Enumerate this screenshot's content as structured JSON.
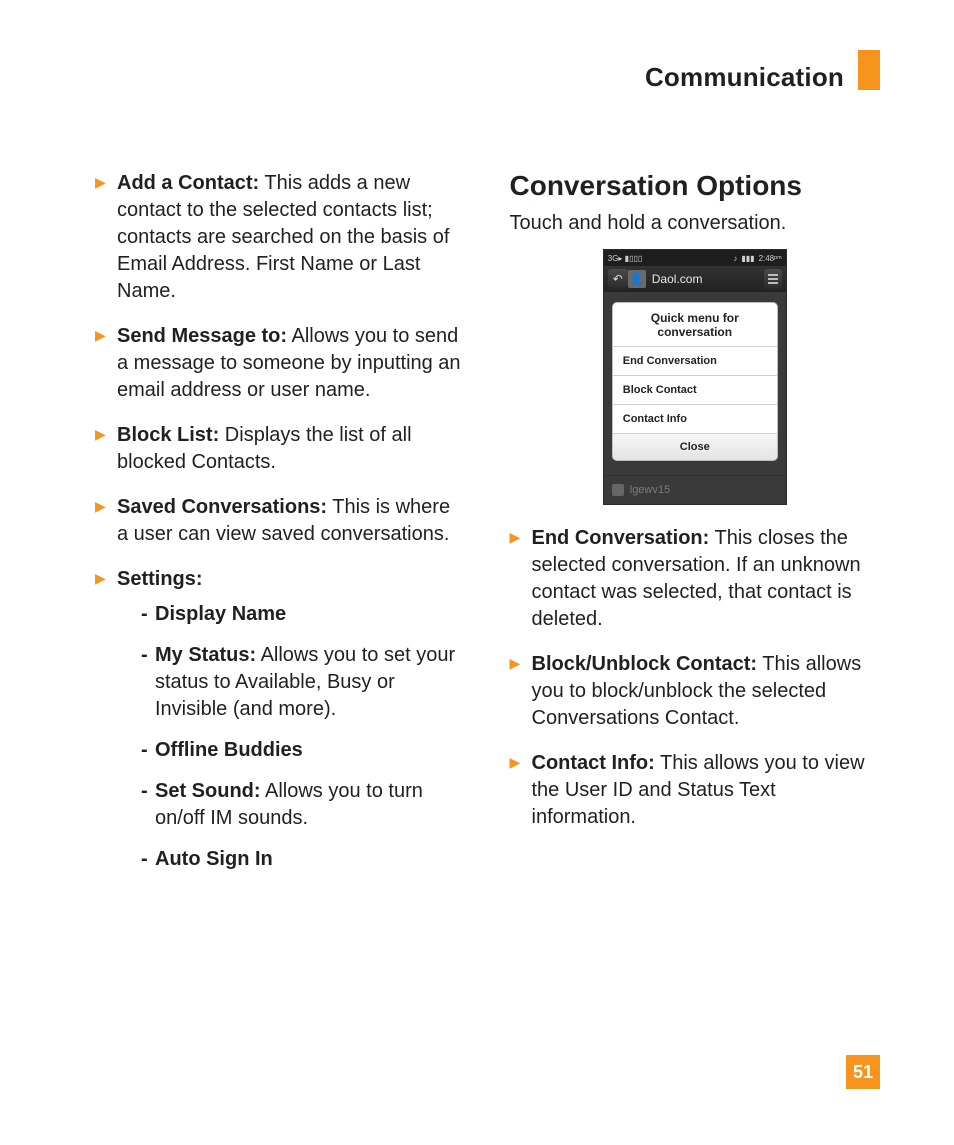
{
  "header": {
    "section": "Communication"
  },
  "page_number": "51",
  "left": {
    "items": [
      {
        "label": "Add a Contact:",
        "text": " This adds a new contact to the selected contacts list; contacts are searched on the basis of Email Address. First Name or Last Name."
      },
      {
        "label": "Send Message to:",
        "text": " Allows you to send a message to someone by inputting an email address or user name."
      },
      {
        "label": "Block List:",
        "text": " Displays the list of all blocked Contacts."
      },
      {
        "label": "Saved Conversations:",
        "text": " This is where a user can view saved conversations."
      },
      {
        "label": "Settings:",
        "text": ""
      }
    ],
    "settings_sub": [
      {
        "label": "Display Name",
        "text": ""
      },
      {
        "label": "My Status:",
        "text": " Allows you to set your status to Available, Busy or Invisible (and more)."
      },
      {
        "label": "Offline Buddies",
        "text": ""
      },
      {
        "label": "Set Sound:",
        "text": " Allows you to turn on/off IM sounds."
      },
      {
        "label": "Auto Sign In",
        "text": ""
      }
    ]
  },
  "right": {
    "heading": "Conversation Options",
    "intro": "Touch and hold a conversation.",
    "items": [
      {
        "label": "End Conversation:",
        "text": " This closes the selected conversation. If an unknown contact was selected, that contact is deleted."
      },
      {
        "label": "Block/Unblock Contact:",
        "text": " This allows you to block/unblock the selected Conversations Contact."
      },
      {
        "label": "Contact Info:",
        "text": " This allows you to view the User ID and Status Text information."
      }
    ]
  },
  "phone": {
    "status_left": "3G▸ ▮▯▯▯",
    "status_right": "2:48ᵖᵐ",
    "title": "Daol.com",
    "card_title_1": "Quick menu for",
    "card_title_2": "conversation",
    "menu_items": [
      "End Conversation",
      "Block Contact",
      "Contact Info"
    ],
    "close": "Close",
    "bg_row": "lgewv15"
  }
}
